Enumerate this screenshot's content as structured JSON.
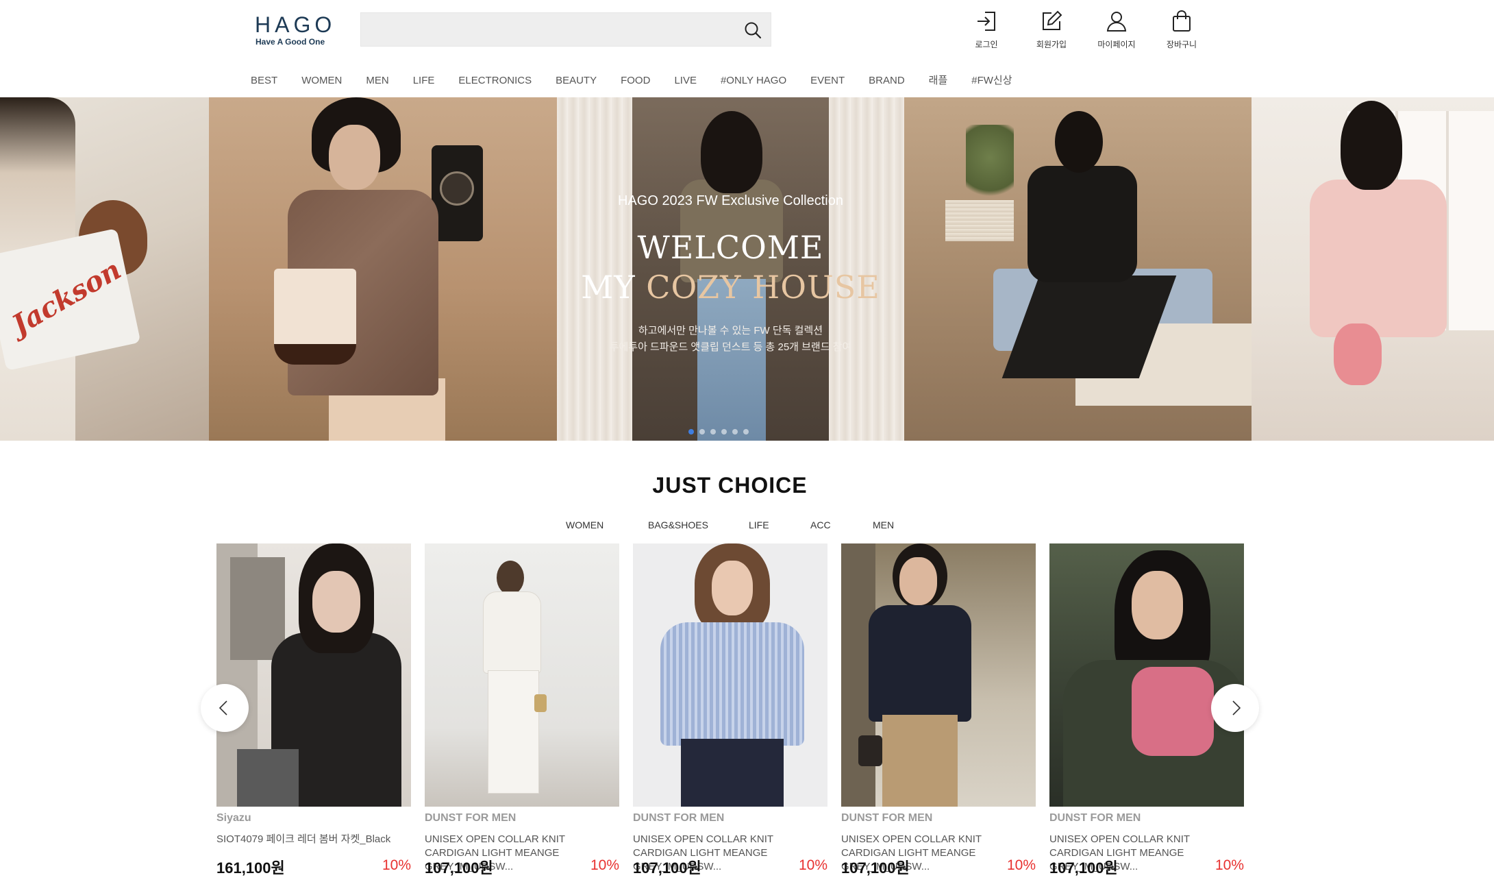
{
  "header": {
    "logo_main": "HAGO",
    "logo_sub": "Have A Good One",
    "search": {
      "placeholder": "",
      "value": ""
    },
    "utils": [
      {
        "label": "로그인",
        "icon": "login-icon"
      },
      {
        "label": "회원가입",
        "icon": "edit-icon"
      },
      {
        "label": "마이페이지",
        "icon": "user-icon"
      },
      {
        "label": "장바구니",
        "icon": "shopping-bag-icon"
      }
    ]
  },
  "gnb": [
    "BEST",
    "WOMEN",
    "MEN",
    "LIFE",
    "ELECTRONICS",
    "BEAUTY",
    "FOOD",
    "LIVE",
    "#ONLY HAGO",
    "EVENT",
    "BRAND",
    "래플",
    "#FW신상"
  ],
  "hero": {
    "eyebrow": "HAGO 2023 FW Exclusive Collection",
    "title_line1": "WELCOME",
    "title_line2_prefix": "MY ",
    "title_line2_accent": "COZY HOUSE",
    "desc_line1": "하고에서만 만나볼 수 있는 FW 단독 컬렉션",
    "desc_line2": "투에투아 드파운드 앳클립 던스트 등 총 25개 브랜드 참여",
    "pizza_brand": "Jackson",
    "slides_total": 6,
    "active_slide": 1,
    "accent_color": "#e7c6a2"
  },
  "just_choice": {
    "title": "JUST CHOICE",
    "tabs": [
      "WOMEN",
      "BAG&SHOES",
      "LIFE",
      "ACC",
      "MEN"
    ],
    "products": [
      {
        "brand": "Siyazu",
        "name": "SIOT4079 페이크 레더 봄버 자켓_Black",
        "price": "161,100원",
        "discount": "10%"
      },
      {
        "brand": "DUNST FOR MEN",
        "name": "UNISEX OPEN COLLAR KNIT CARDIGAN LIGHT MEANGE GREY_M_UDSW...",
        "price": "107,100원",
        "discount": "10%"
      },
      {
        "brand": "DUNST FOR MEN",
        "name": "UNISEX OPEN COLLAR KNIT CARDIGAN LIGHT MEANGE GREY_M_UDSW...",
        "price": "107,100원",
        "discount": "10%"
      },
      {
        "brand": "DUNST FOR MEN",
        "name": "UNISEX OPEN COLLAR KNIT CARDIGAN LIGHT MEANGE GREY_M_UDSW...",
        "price": "107,100원",
        "discount": "10%"
      },
      {
        "brand": "DUNST FOR MEN",
        "name": "UNISEX OPEN COLLAR KNIT CARDIGAN LIGHT MEANGE GREY_M_UDSW...",
        "price": "107,100원",
        "discount": "10%"
      }
    ]
  },
  "colors": {
    "brand_navy": "#1d3a55",
    "discount_red": "#e8312f",
    "active_dot": "#3f7ee0"
  }
}
